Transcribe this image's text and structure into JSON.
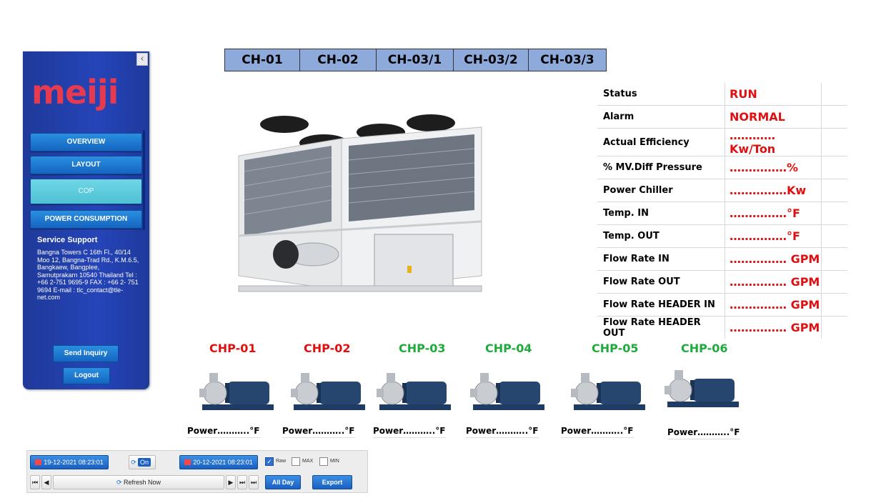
{
  "sidebar": {
    "logo": "meiji",
    "nav": [
      "OVERVIEW",
      "LAYOUT",
      "COP",
      "POWER CONSUMPTION"
    ],
    "support_title": "Service Support",
    "support_text": "Bangna Towers C 16th Fl., 40/14 Moo 12, Bangna-Trad Rd., K.M.6.5, Bangkaew, Bangplee, Samutprakarn 10540 Thailand Tel : +66 2-751 9695-9 FAX : +66 2- 751 9694 E-mail : tlc_contact@tle-net.com",
    "send_inquiry": "Send Inquiry",
    "logout": "Logout",
    "collapse_icon": "‹"
  },
  "tabs": [
    "CH-01",
    "CH-02",
    "CH-03/1",
    "CH-03/2",
    "CH-03/3"
  ],
  "status": [
    {
      "label": "Status",
      "value": "RUN"
    },
    {
      "label": "Alarm",
      "value": "NORMAL"
    },
    {
      "label": "Actual Efficiency",
      "value": "…………Kw/Ton"
    },
    {
      "label": "% MV.Diff Pressure",
      "value": "……………%"
    },
    {
      "label": "Power Chiller",
      "value": "……………Kw"
    },
    {
      "label": "Temp. IN",
      "value": "……………°F"
    },
    {
      "label": "Temp. OUT",
      "value": "……………°F"
    },
    {
      "label": "Flow Rate IN",
      "value": "…………… GPM"
    },
    {
      "label": "Flow Rate OUT",
      "value": "…………… GPM"
    },
    {
      "label": "Flow Rate HEADER  IN",
      "value": "…………… GPM"
    },
    {
      "label": "Flow Rate HEADER OUT",
      "value": "…………… GPM"
    }
  ],
  "pumps": [
    {
      "name": "CHP-01",
      "color": "#e01010",
      "power": "Power………..°F"
    },
    {
      "name": "CHP-02",
      "color": "#e01010",
      "power": "Power………..°F"
    },
    {
      "name": "CHP-03",
      "color": "#1faa3c",
      "power": "Power………..°F"
    },
    {
      "name": "CHP-04",
      "color": "#1faa3c",
      "power": "Power………..°F"
    },
    {
      "name": "CHP-05",
      "color": "#1faa3c",
      "power": "Power………..°F"
    },
    {
      "name": "CHP-06",
      "color": "#1faa3c",
      "power": "Power………..°F"
    }
  ],
  "toolbar": {
    "start_date": "19-12-2021 08:23:01",
    "auto_label": "On",
    "end_date": "20-12-2021 08:23:01",
    "raw_label": "Raw",
    "max_label": "MAX",
    "min_label": "MIN",
    "refresh_label": "Refresh Now",
    "allday_label": "All Day",
    "export_label": "Export"
  }
}
